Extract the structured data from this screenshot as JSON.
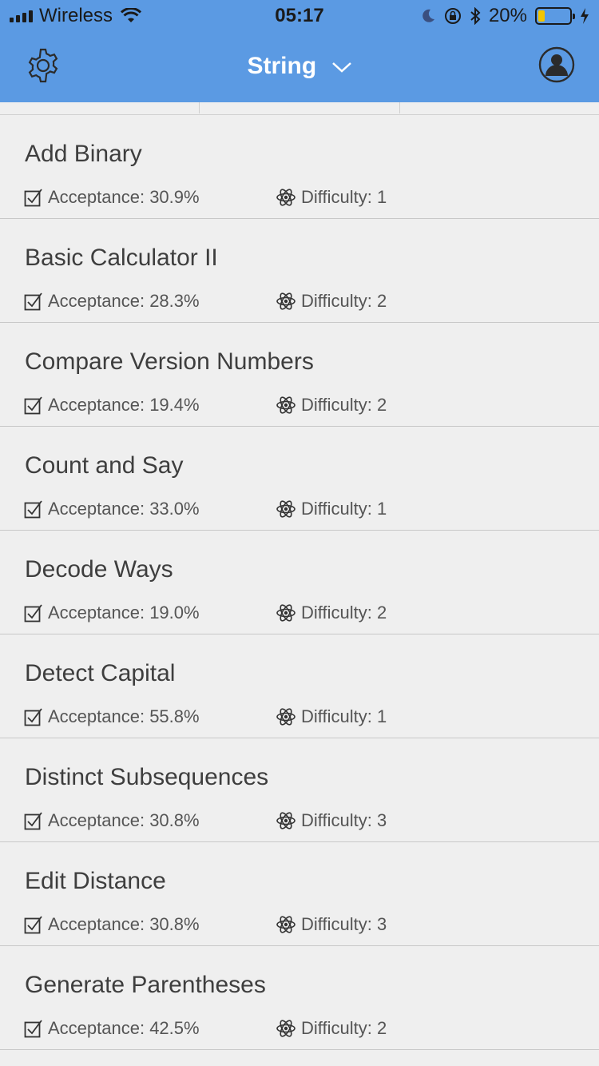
{
  "status": {
    "carrier": "Wireless",
    "time": "05:17",
    "battery": "20%",
    "battery_level": 0.2
  },
  "nav": {
    "title": "String",
    "settings_icon": "gear-icon",
    "profile_icon": "person-icon"
  },
  "problems": [
    {
      "name": "Add Binary",
      "acceptance": "Acceptance: 30.9%",
      "difficulty": "Difficulty: 1"
    },
    {
      "name": "Basic Calculator II",
      "acceptance": "Acceptance: 28.3%",
      "difficulty": "Difficulty: 2"
    },
    {
      "name": "Compare Version Numbers",
      "acceptance": "Acceptance: 19.4%",
      "difficulty": "Difficulty: 2"
    },
    {
      "name": "Count and Say",
      "acceptance": "Acceptance: 33.0%",
      "difficulty": "Difficulty: 1"
    },
    {
      "name": "Decode Ways",
      "acceptance": "Acceptance: 19.0%",
      "difficulty": "Difficulty: 2"
    },
    {
      "name": "Detect Capital",
      "acceptance": "Acceptance: 55.8%",
      "difficulty": "Difficulty: 1"
    },
    {
      "name": "Distinct Subsequences",
      "acceptance": "Acceptance: 30.8%",
      "difficulty": "Difficulty: 3"
    },
    {
      "name": "Edit Distance",
      "acceptance": "Acceptance: 30.8%",
      "difficulty": "Difficulty: 3"
    },
    {
      "name": "Generate Parentheses",
      "acceptance": "Acceptance: 42.5%",
      "difficulty": "Difficulty: 2"
    }
  ]
}
